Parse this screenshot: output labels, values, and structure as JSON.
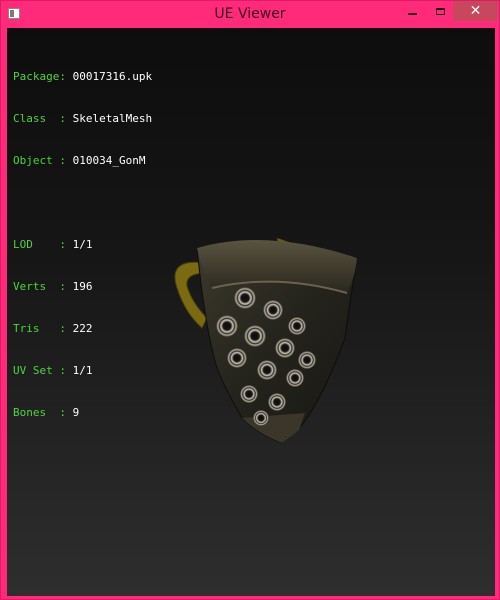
{
  "window": {
    "title": "UE Viewer",
    "close_glyph": "✕"
  },
  "info_block_1": [
    {
      "key": "Package:",
      "value": "00017316.upk"
    },
    {
      "key": "Class  :",
      "value": "SkeletalMesh"
    },
    {
      "key": "Object :",
      "value": "010034_GonM"
    }
  ],
  "info_block_2": [
    {
      "key": "LOD    :",
      "value": "1/1"
    },
    {
      "key": "Verts  :",
      "value": "196"
    },
    {
      "key": "Tris   :",
      "value": "222"
    },
    {
      "key": "UV Set :",
      "value": "1/1"
    },
    {
      "key": "Bones  :",
      "value": "9"
    }
  ],
  "colors": {
    "titlebar": "#ff2a7a",
    "label": "#4bd63a",
    "value": "#ffffff",
    "close_button": "#c7475f"
  },
  "icons": {
    "app": "app-window-icon",
    "minimize": "minimize-icon",
    "maximize": "maximize-icon",
    "close": "close-icon"
  }
}
